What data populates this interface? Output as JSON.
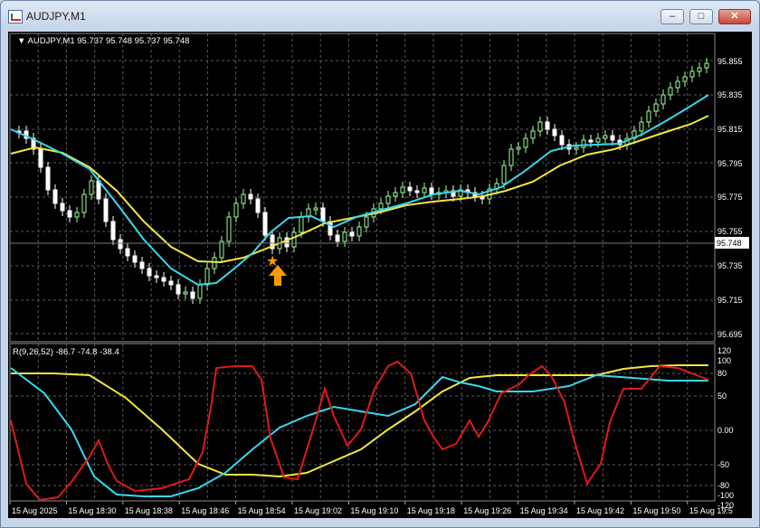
{
  "window": {
    "title": "AUDJPY,M1",
    "minimize_glyph": "–",
    "maximize_glyph": "□",
    "close_glyph": "✕"
  },
  "price_panel": {
    "info": "▼ AUDJPY,M1  95.737 95.748 95.737 95.748",
    "current_price": "95.748",
    "price_axis": [
      "95.855",
      "95.835",
      "95.815",
      "95.795",
      "95.775",
      "95.755",
      "95.735",
      "95.715",
      "95.695"
    ]
  },
  "indicator_panel": {
    "info": "R(9,26,52) -86.7 -74.8 -38.4",
    "axis": [
      "120",
      "100",
      "80",
      "50",
      "0.00",
      "-50",
      "-80",
      "-100",
      "-120"
    ]
  },
  "time_axis": [
    "15 Aug 2025",
    "15 Aug 18:30",
    "15 Aug 18:38",
    "15 Aug 18:46",
    "15 Aug 18:54",
    "15 Aug 19:02",
    "15 Aug 19:10",
    "15 Aug 19:18",
    "15 Aug 19:26",
    "15 Aug 19:34",
    "15 Aug 19:42",
    "15 Aug 19:50",
    "15 Aug 19:5"
  ],
  "colors": {
    "background": "#000000",
    "grid": "#5a5a5a",
    "bull_candle": "#9cff9c",
    "bear_candle": "#ffffff",
    "ma_fast": "#38d8ee",
    "ma_slow": "#f2e640",
    "osc_red": "#e01a1a",
    "signal_arrow": "#ff9a00"
  },
  "signal": {
    "type": "buy-arrow",
    "star": "★",
    "arrow": "🡅"
  }
}
